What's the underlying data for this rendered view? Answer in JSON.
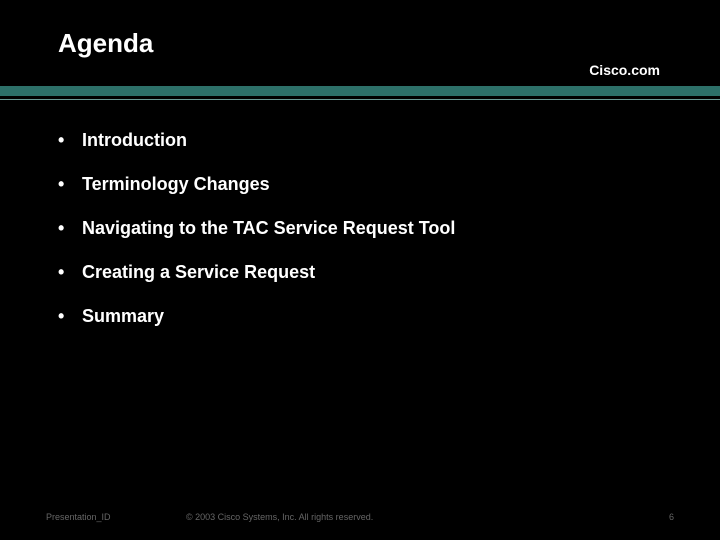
{
  "title": "Agenda",
  "brand": "Cisco.com",
  "bullets": {
    "0": "Introduction",
    "1": "Terminology Changes",
    "2": "Navigating to the TAC Service Request Tool",
    "3": "Creating a Service Request",
    "4": "Summary"
  },
  "footer": {
    "left": "Presentation_ID",
    "center": "© 2003 Cisco Systems, Inc. All rights reserved.",
    "right": "6"
  }
}
